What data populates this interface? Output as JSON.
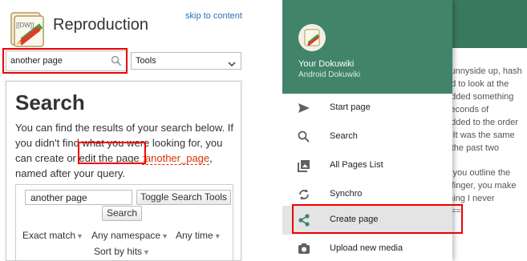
{
  "desktop": {
    "site_title": "Reproduction",
    "skip_link": "skip to content",
    "search_value": "another page",
    "tools_label": "Tools",
    "logo_text": "[[DW]]",
    "page_title": "Search",
    "intro_before": "You can find the results of your search below. If you didn't find what you were looking for, you can create or edit the page ",
    "intro_link": ":another_page",
    "intro_after": ", named after your query.",
    "query_value": "another page",
    "toggle_label": "Toggle Search Tools",
    "search_button": "Search",
    "filter_exact": "Exact match",
    "filter_namespace": "Any namespace",
    "filter_time": "Any time",
    "sort_label": "Sort by hits"
  },
  "app": {
    "title": "Your Dokuwiki",
    "subtitle": "Android Dokuwiki",
    "bg_lines": [
      "sunnyside up, hash",
      "ed to look at the",
      "added something",
      "seconds of",
      "added to the order",
      "l. It was the same",
      "r the past two",
      "if you outline the",
      "r finger, you make",
      "thing I never",
      "?=="
    ],
    "menu": [
      {
        "label": "Start page",
        "icon": "send-icon"
      },
      {
        "label": "Search",
        "icon": "search-icon"
      },
      {
        "label": "All Pages List",
        "icon": "photo-library-icon"
      },
      {
        "label": "Synchro",
        "icon": "sync-icon"
      },
      {
        "label": "Create page",
        "icon": "share-icon"
      },
      {
        "label": "Upload new media",
        "icon": "camera-icon"
      }
    ],
    "accent_color": "#41846a"
  }
}
